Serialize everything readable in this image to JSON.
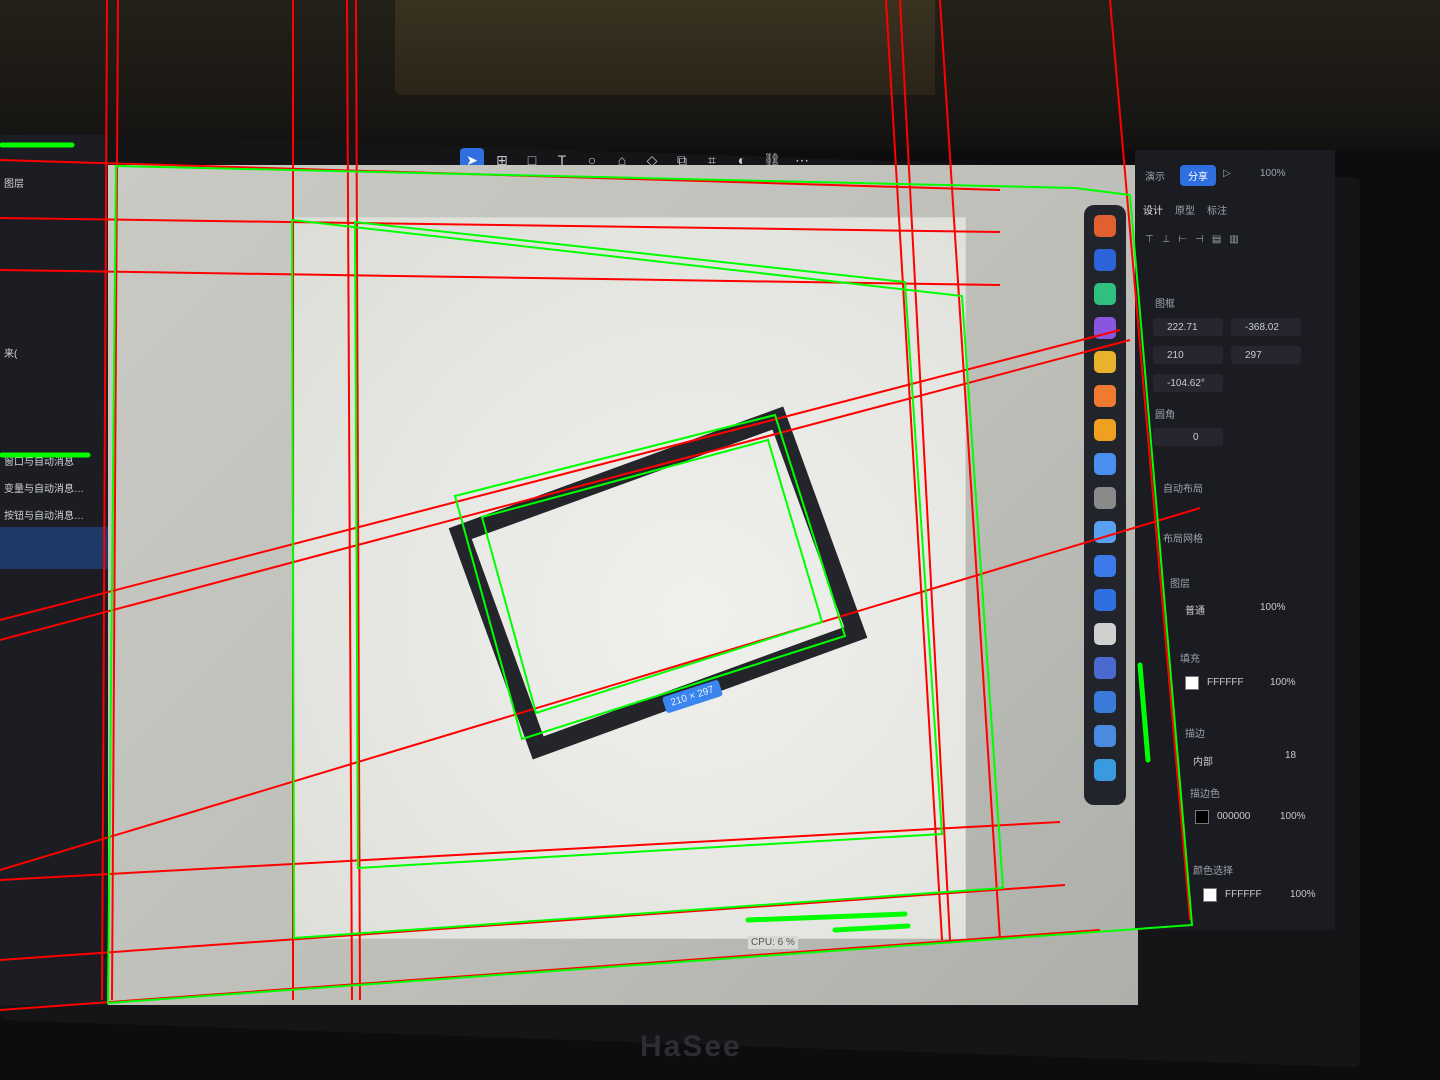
{
  "toolbar": {
    "tools": [
      "select-tool",
      "frame-tool",
      "rectangle-tool",
      "text-tool",
      "ellipse-tool",
      "pen-tool",
      "component-tool",
      "boolean-tool",
      "crop-tool",
      "contrast-tool",
      "link-tool",
      "more-tool"
    ]
  },
  "left_panel": {
    "lines": [
      "图层",
      "来(",
      "窗口与自动消息",
      "变量与自动消息…",
      "按钮与自动消息…"
    ]
  },
  "header_right": {
    "preview_label": "演示",
    "share_label": "分享",
    "zoom_label": "100%"
  },
  "properties": {
    "tabs": [
      "设计",
      "原型",
      "标注"
    ],
    "frame_label": "图框",
    "x": "222.71",
    "y": "-368.02",
    "w": "210",
    "h": "297",
    "rotation": "-104.62°",
    "corner_label": "圆角",
    "corner_value": "0",
    "auto_layout_label": "自动布局",
    "layout_grid_label": "布局网格",
    "layer_label": "图层",
    "layer_mode": "普通",
    "layer_opacity": "100%",
    "fill_label": "填充",
    "fill_hex": "FFFFFF",
    "fill_opacity": "100%",
    "stroke_label": "描边",
    "stroke_position": "内部",
    "stroke_width": "18",
    "stroke_color_label": "描边色",
    "stroke_hex": "000000",
    "stroke_opacity": "100%",
    "selection_colors_label": "颜色选择",
    "selection_hex": "FFFFFF",
    "selection_opacity": "100%"
  },
  "canvas": {
    "dimension_badge": "210 × 297",
    "cpu_label": "CPU: 6 %"
  },
  "plugins": {
    "icons": [
      "plugin-1-icon",
      "plugin-2-icon",
      "plugin-3-icon",
      "plugin-4-icon",
      "plugin-5-icon",
      "plugin-6-icon",
      "plugin-7-icon",
      "plugin-8-icon",
      "plugin-9-icon",
      "plugin-10-icon",
      "plugin-11-icon",
      "plugin-12-icon",
      "plugin-13-icon",
      "plugin-14-icon",
      "plugin-15-icon",
      "plugin-16-icon",
      "plugin-17-icon"
    ],
    "colors": [
      "#e0602f",
      "#2c63d8",
      "#2fbf7f",
      "#8a56e0",
      "#e8b22d",
      "#f07a30",
      "#f0a020",
      "#4a8ef0",
      "#8a8a8a",
      "#5aa0f0",
      "#3b7ae8",
      "#2f6fe0",
      "#d0d0d0",
      "#4a6ad0",
      "#3a7ad8",
      "#4a8ae0",
      "#3a9ae0"
    ]
  },
  "monitor": {
    "brand": "HaSee"
  },
  "colors": {
    "accent": "#2f6fe0",
    "detect_green": "#00ff00",
    "detect_red": "#ff0000",
    "shape_stroke": "#23252b"
  }
}
